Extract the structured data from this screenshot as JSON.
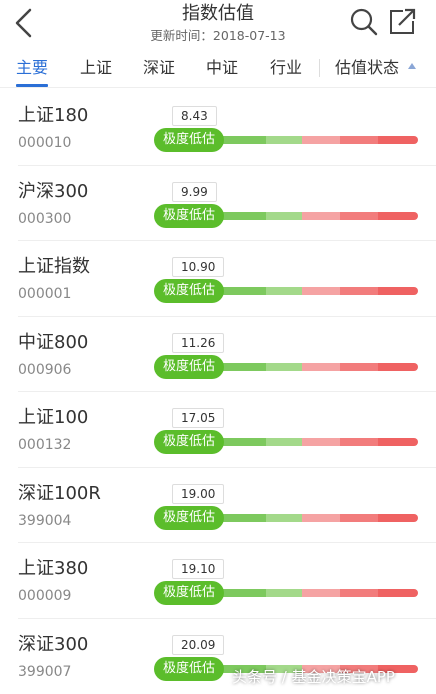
{
  "header": {
    "title": "指数估值",
    "update_label": "更新时间：",
    "update_date": "2018-07-13"
  },
  "tabs": [
    "主要",
    "上证",
    "深证",
    "中证",
    "行业",
    "估值状态"
  ],
  "colors": {
    "accent": "#2b6fd6",
    "undervalued": "#5bbd2b",
    "gauge": [
      "#7dc95e",
      "#a3d98a",
      "#f5a3a3",
      "#f27c7c",
      "#ef6262"
    ]
  },
  "status_label": "极度低估",
  "indices": [
    {
      "name": "上证180",
      "code": "000010",
      "value": "8.43"
    },
    {
      "name": "沪深300",
      "code": "000300",
      "value": "9.99"
    },
    {
      "name": "上证指数",
      "code": "000001",
      "value": "10.90"
    },
    {
      "name": "中证800",
      "code": "000906",
      "value": "11.26"
    },
    {
      "name": "上证100",
      "code": "000132",
      "value": "17.05"
    },
    {
      "name": "深证100R",
      "code": "399004",
      "value": "19.00"
    },
    {
      "name": "上证380",
      "code": "000009",
      "value": "19.10"
    },
    {
      "name": "深证300",
      "code": "399007",
      "value": "20.09"
    }
  ],
  "watermark": "头条号 / 基金决策宝APP"
}
